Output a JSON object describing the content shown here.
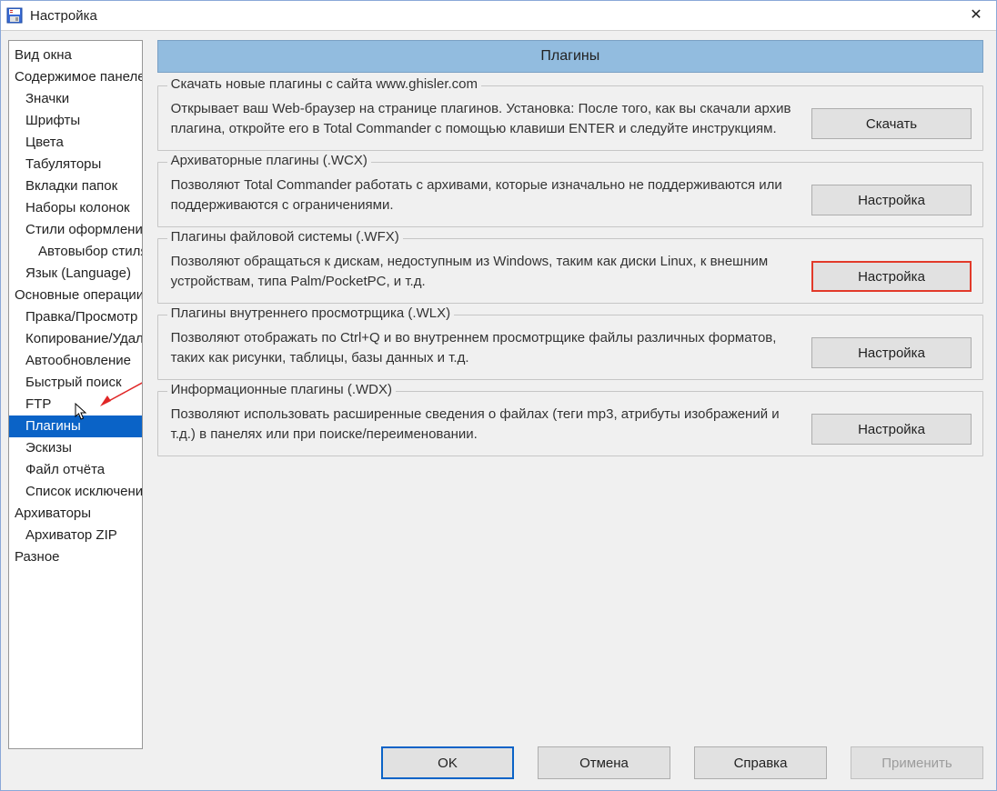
{
  "window": {
    "title": "Настройка",
    "close_glyph": "✕"
  },
  "tree": {
    "items": [
      {
        "label": "Вид окна",
        "indent": 0,
        "selected": false
      },
      {
        "label": "Содержимое панелей",
        "indent": 0,
        "selected": false
      },
      {
        "label": "Значки",
        "indent": 1,
        "selected": false
      },
      {
        "label": "Шрифты",
        "indent": 1,
        "selected": false
      },
      {
        "label": "Цвета",
        "indent": 1,
        "selected": false
      },
      {
        "label": "Табуляторы",
        "indent": 1,
        "selected": false
      },
      {
        "label": "Вкладки папок",
        "indent": 1,
        "selected": false
      },
      {
        "label": "Наборы колонок",
        "indent": 1,
        "selected": false
      },
      {
        "label": "Стили оформления",
        "indent": 1,
        "selected": false
      },
      {
        "label": "Автовыбор стиля",
        "indent": 2,
        "selected": false
      },
      {
        "label": "Язык (Language)",
        "indent": 1,
        "selected": false
      },
      {
        "label": "Основные операции",
        "indent": 0,
        "selected": false
      },
      {
        "label": "Правка/Просмотр",
        "indent": 1,
        "selected": false
      },
      {
        "label": "Копирование/Удаление",
        "indent": 1,
        "selected": false
      },
      {
        "label": "Автообновление",
        "indent": 1,
        "selected": false
      },
      {
        "label": "Быстрый поиск",
        "indent": 1,
        "selected": false
      },
      {
        "label": "FTP",
        "indent": 1,
        "selected": false
      },
      {
        "label": "Плагины",
        "indent": 1,
        "selected": true
      },
      {
        "label": "Эскизы",
        "indent": 1,
        "selected": false
      },
      {
        "label": "Файл отчёта",
        "indent": 1,
        "selected": false
      },
      {
        "label": "Список исключений",
        "indent": 1,
        "selected": false
      },
      {
        "label": "Архиваторы",
        "indent": 0,
        "selected": false
      },
      {
        "label": "Архиватор ZIP",
        "indent": 1,
        "selected": false
      },
      {
        "label": "Разное",
        "indent": 0,
        "selected": false
      }
    ]
  },
  "page": {
    "header": "Плагины",
    "groups": [
      {
        "title": "Скачать новые плагины с сайта www.ghisler.com",
        "text": "Открывает ваш Web-браузер на странице плагинов. Установка: После того, как вы скачали архив плагина, откройте его в Total Commander с помощью клавиши ENTER и следуйте инструкциям.",
        "button": "Скачать",
        "highlight": false
      },
      {
        "title": "Архиваторные плагины (.WCX)",
        "text": "Позволяют Total Commander работать с архивами, которые изначально не поддерживаются или поддерживаются с ограничениями.",
        "button": "Настройка",
        "highlight": false
      },
      {
        "title": "Плагины файловой системы (.WFX)",
        "text": "Позволяют обращаться к дискам, недоступным из Windows, таким как диски Linux, к внешним устройствам, типа Palm/PocketPC, и т.д.",
        "button": "Настройка",
        "highlight": true
      },
      {
        "title": "Плагины внутреннего просмотрщика (.WLX)",
        "text": "Позволяют отображать по Ctrl+Q и во внутреннем просмотрщике файлы различных форматов, таких как рисунки, таблицы, базы данных и т.д.",
        "button": "Настройка",
        "highlight": false
      },
      {
        "title": "Информационные плагины (.WDX)",
        "text": "Позволяют использовать расширенные сведения о файлах (теги mp3, атрибуты изображений и т.д.) в панелях или при поиске/переименовании.",
        "button": "Настройка",
        "highlight": false
      }
    ]
  },
  "footer": {
    "ok": "OK",
    "cancel": "Отмена",
    "help": "Справка",
    "apply": "Применить"
  },
  "colors": {
    "accent": "#0a63c7",
    "highlight_border": "#e23a2a",
    "header_bg": "#92bcdf"
  }
}
